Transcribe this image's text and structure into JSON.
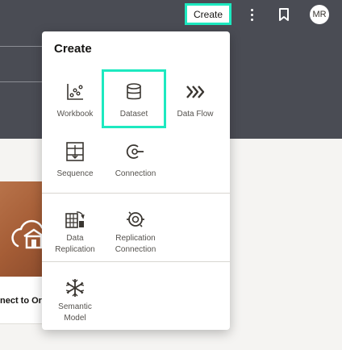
{
  "header": {
    "create_label": "Create",
    "avatar_initials": "MR"
  },
  "background": {
    "card_title": "nect to Or"
  },
  "create_menu": {
    "title": "Create",
    "items": [
      {
        "label": "Workbook",
        "icon": "workbook-icon"
      },
      {
        "label": "Dataset",
        "icon": "dataset-icon"
      },
      {
        "label": "Data Flow",
        "icon": "data-flow-icon"
      },
      {
        "label": "Sequence",
        "icon": "sequence-icon"
      },
      {
        "label": "Connection",
        "icon": "connection-icon"
      },
      {
        "label": "Data\nReplication",
        "icon": "data-replication-icon"
      },
      {
        "label": "Replication\nConnection",
        "icon": "replication-connection-icon"
      },
      {
        "label": "Semantic\nModel",
        "icon": "semantic-model-icon"
      }
    ]
  },
  "colors": {
    "topbar": "#4a4c54",
    "highlight": "#1de9c0",
    "icon": "#3a3631"
  }
}
